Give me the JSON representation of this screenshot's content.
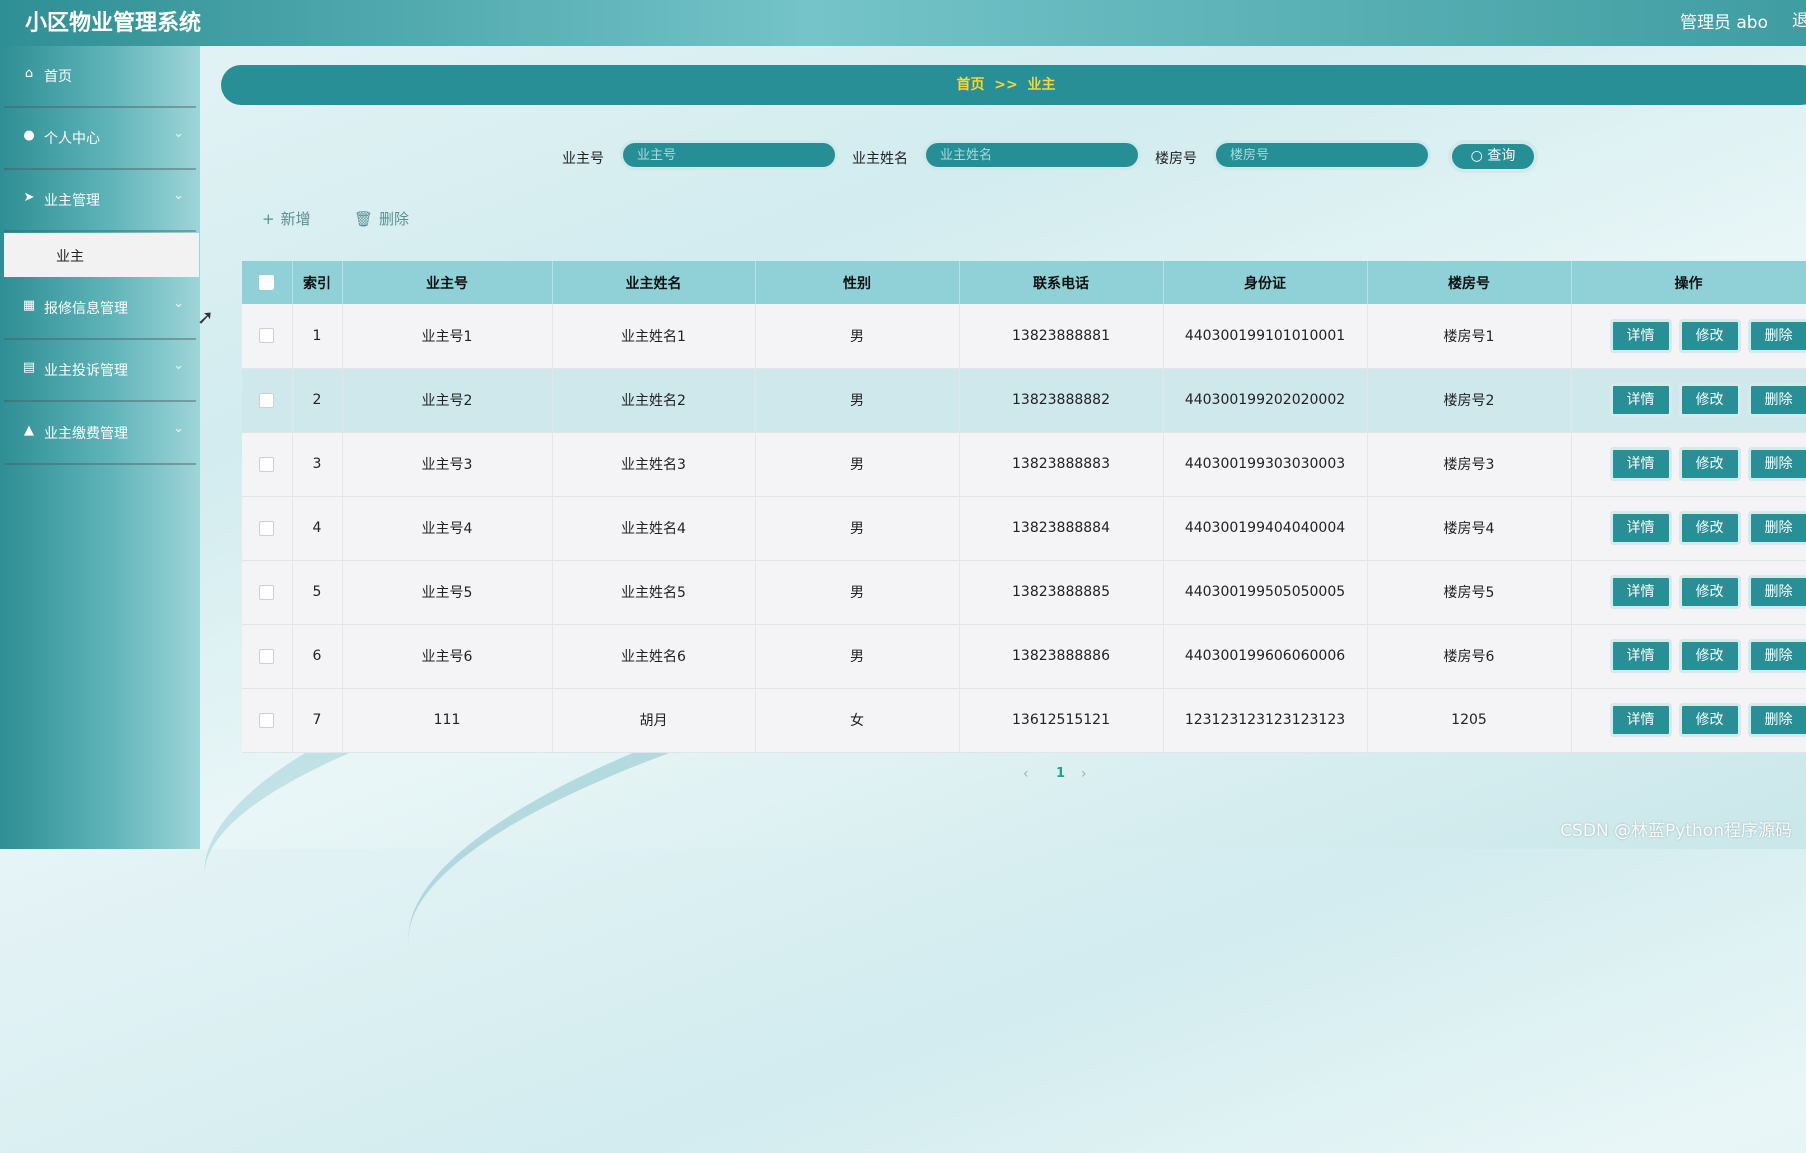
{
  "app": {
    "title": "小区物业管理系统",
    "user": "管理员 abo",
    "user_cut": "退"
  },
  "sidebar": {
    "items": [
      {
        "label": "首页",
        "icon": "home-icon",
        "glyph": "⌂"
      },
      {
        "label": "个人中心",
        "icon": "user-icon",
        "glyph": "●"
      },
      {
        "label": "业主管理",
        "icon": "send-icon",
        "glyph": "➤"
      },
      {
        "label": "报修信息管理",
        "icon": "grid-icon",
        "glyph": "▦"
      },
      {
        "label": "业主投诉管理",
        "icon": "clipboard-icon",
        "glyph": "▤"
      },
      {
        "label": "业主缴费管理",
        "icon": "user-upload-icon",
        "glyph": "▲"
      }
    ],
    "active_sub": "业主",
    "chevron": "⌄"
  },
  "breadcrumb": {
    "home": "首页",
    "sep": ">>",
    "current": "业主"
  },
  "search": {
    "owner_no_label": "业主号",
    "owner_no_placeholder": "业主号",
    "owner_name_label": "业主姓名",
    "owner_name_placeholder": "业主姓名",
    "room_label": "楼房号",
    "room_placeholder": "楼房号",
    "query_label": "查询",
    "query_icon": "○"
  },
  "toolbar": {
    "add_label": "新增",
    "add_icon": "+",
    "delete_label": "删除",
    "delete_icon": "🗑"
  },
  "table": {
    "columns": [
      "索引",
      "业主号",
      "业主姓名",
      "性别",
      "联系电话",
      "身份证",
      "楼房号",
      "操作"
    ],
    "rows": [
      {
        "index": "1",
        "owner_no": "业主号1",
        "name": "业主姓名1",
        "gender": "男",
        "phone": "13823888881",
        "id_card": "440300199101010001",
        "room": "楼房号1"
      },
      {
        "index": "2",
        "owner_no": "业主号2",
        "name": "业主姓名2",
        "gender": "男",
        "phone": "13823888882",
        "id_card": "440300199202020002",
        "room": "楼房号2"
      },
      {
        "index": "3",
        "owner_no": "业主号3",
        "name": "业主姓名3",
        "gender": "男",
        "phone": "13823888883",
        "id_card": "440300199303030003",
        "room": "楼房号3"
      },
      {
        "index": "4",
        "owner_no": "业主号4",
        "name": "业主姓名4",
        "gender": "男",
        "phone": "13823888884",
        "id_card": "440300199404040004",
        "room": "楼房号4"
      },
      {
        "index": "5",
        "owner_no": "业主号5",
        "name": "业主姓名5",
        "gender": "男",
        "phone": "13823888885",
        "id_card": "440300199505050005",
        "room": "楼房号5"
      },
      {
        "index": "6",
        "owner_no": "业主号6",
        "name": "业主姓名6",
        "gender": "男",
        "phone": "13823888886",
        "id_card": "440300199606060006",
        "room": "楼房号6"
      },
      {
        "index": "7",
        "owner_no": "111",
        "name": "胡月",
        "gender": "女",
        "phone": "13612515121",
        "id_card": "123123123123123123",
        "room": "1205"
      }
    ],
    "actions": {
      "detail": "详情",
      "edit": "修改",
      "delete": "删除"
    }
  },
  "pager": {
    "prev": "‹",
    "current": "1",
    "next": "›"
  },
  "watermark": "CSDN @林蓝Python程序源码",
  "colors": {
    "primary": "#288f96",
    "header_row": "#8fd1d7",
    "breadcrumb_text": "#f5d735"
  }
}
